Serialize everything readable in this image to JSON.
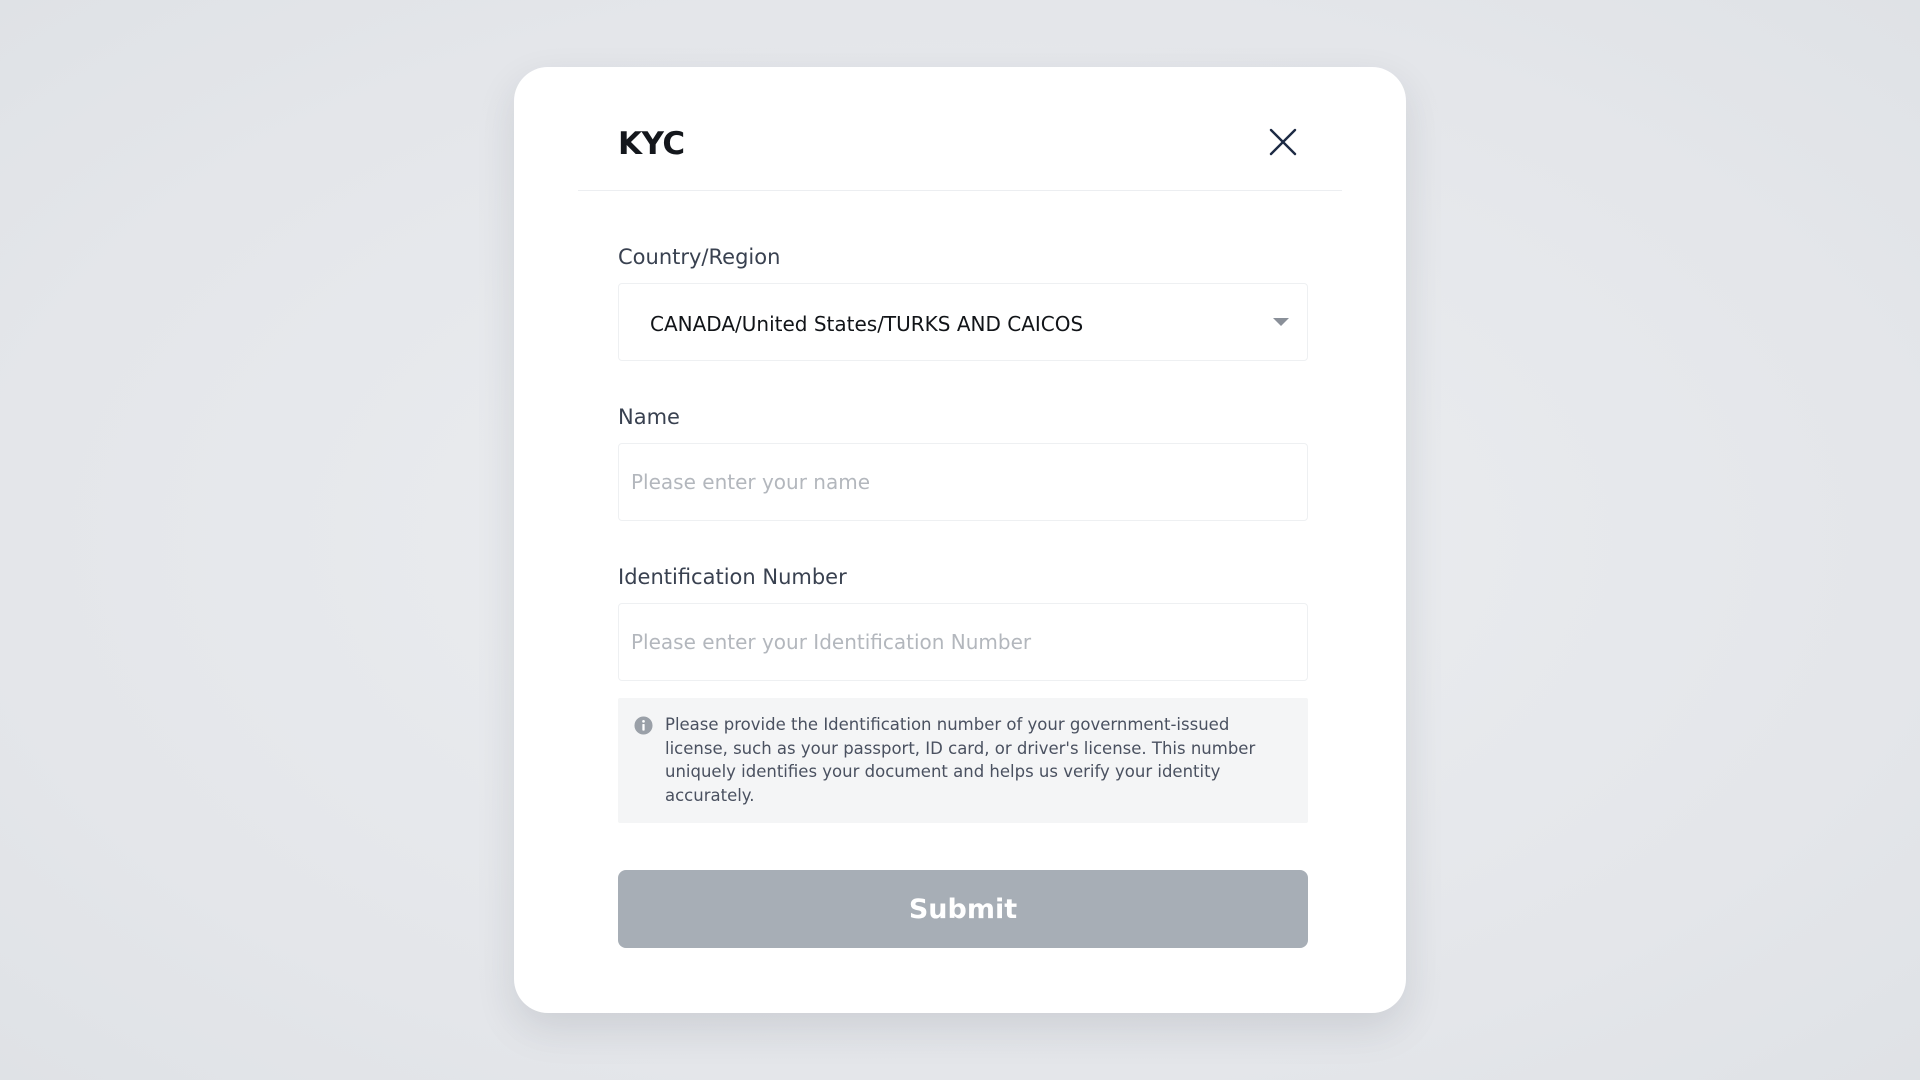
{
  "modal": {
    "title": "KYC",
    "close_icon": "close-icon"
  },
  "form": {
    "country": {
      "label": "Country/Region",
      "value": "CANADA/United States/TURKS AND CAICOS",
      "icon": "chevron-down-icon"
    },
    "name": {
      "label": "Name",
      "value": "",
      "placeholder": "Please enter your name"
    },
    "id_number": {
      "label": "Identification Number",
      "value": "",
      "placeholder": "Please enter your Identification Number"
    },
    "info": {
      "icon": "info-icon",
      "text": "Please provide the Identification number of your government-issued license, such as your passport, ID card, or driver's license. This number uniquely identifies your document and helps us verify your identity accurately."
    },
    "submit_label": "Submit"
  },
  "colors": {
    "submit_disabled": "#a7aeb6",
    "title": "#14171c",
    "label": "#394150",
    "placeholder": "#b3b7bd",
    "info_bg": "#f4f5f6"
  }
}
